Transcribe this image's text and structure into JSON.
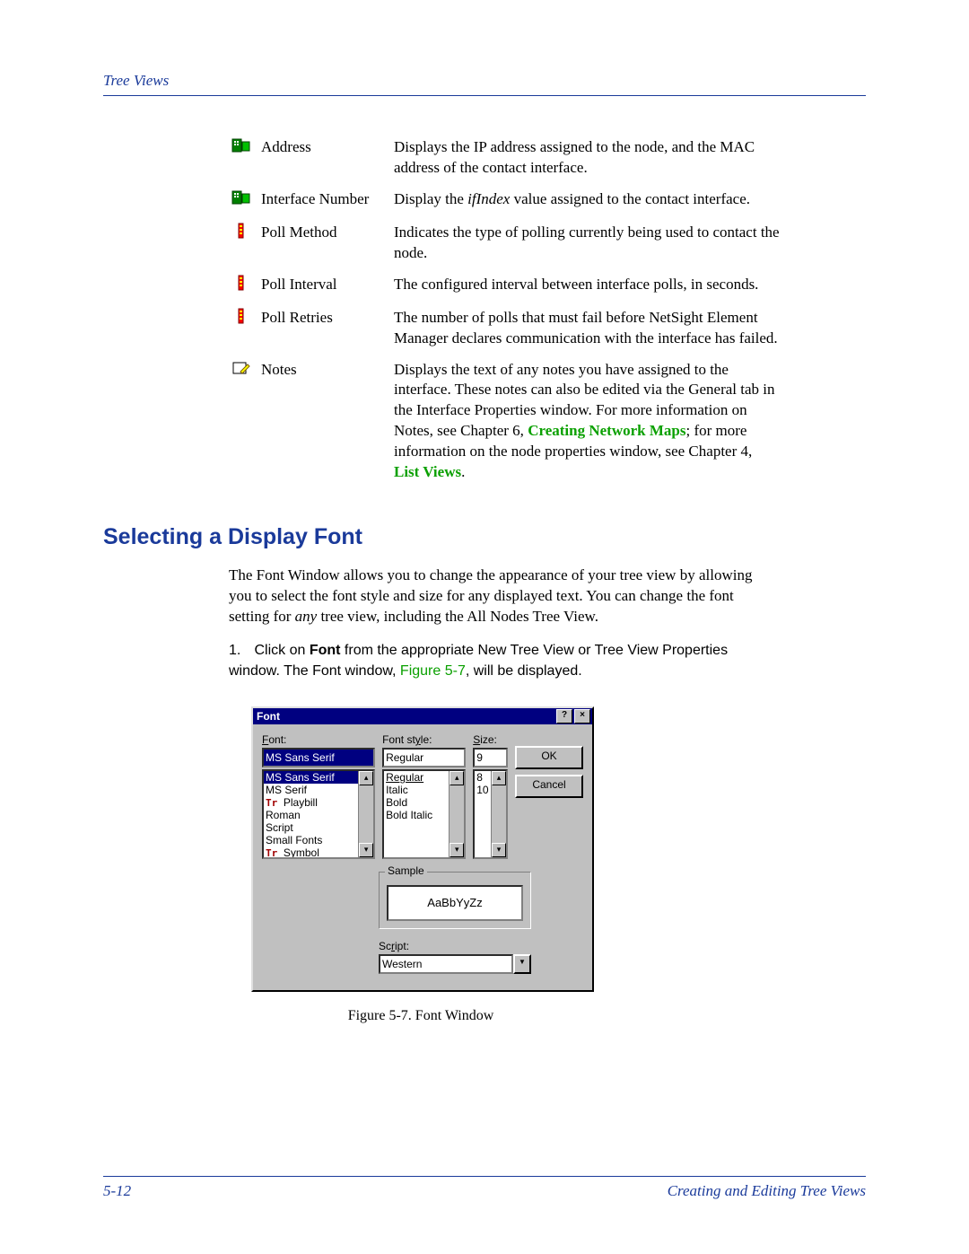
{
  "header": {
    "title": "Tree Views"
  },
  "defs": [
    {
      "icon": "node-icon",
      "term": "Address",
      "desc": "Displays the IP address assigned to the node, and the MAC address of the contact interface."
    },
    {
      "icon": "node-icon",
      "term": "Interface Number",
      "desc_pre": "Display the ",
      "desc_ital": "ifIndex",
      "desc_post": " value assigned to the contact interface."
    },
    {
      "icon": "flag-icon",
      "term": "Poll Method",
      "desc": "Indicates the type of polling currently being used to contact the node."
    },
    {
      "icon": "flag-icon",
      "term": "Poll Interval",
      "desc": "The configured interval between interface polls, in seconds."
    },
    {
      "icon": "flag-icon",
      "term": "Poll Retries",
      "desc": "The number of polls that must fail before NetSight Element Manager declares communication with the interface has failed."
    },
    {
      "icon": "notes-icon",
      "term": "Notes",
      "desc_notes_pre": "Displays the text of any notes you have assigned to the interface. These notes can also be edited via the General tab in the Interface Properties window. For more information on Notes, see Chapter 6, ",
      "link1": "Creating Network Maps",
      "desc_notes_mid": "; for more information on the node properties window, see Chapter 4, ",
      "link2": "List Views",
      "desc_notes_post": "."
    }
  ],
  "section_heading": "Selecting a Display Font",
  "para1_pre": "The Font Window allows you to change the appearance of your tree view by allowing you to select the font style and size for any displayed text. You can change the font setting for ",
  "para1_ital": "any",
  "para1_post": " tree view, including the All Nodes Tree View.",
  "step": {
    "num": "1.",
    "pre": "Click on ",
    "bold": "Font",
    "mid": " from the appropriate New Tree View or Tree View Properties window. The Font window, ",
    "figref": "Figure 5-7",
    "post": ", will be displayed."
  },
  "dialog": {
    "title": "Font",
    "help_btn": "?",
    "close_btn": "×",
    "font_label": "Font:",
    "font_value": "MS Sans Serif",
    "font_list": [
      "MS Sans Serif",
      "MS Serif",
      "Playbill",
      "Roman",
      "Script",
      "Small Fonts",
      "Symbol"
    ],
    "style_label": "Font style:",
    "style_value": "Regular",
    "style_list": [
      "Regular",
      "Italic",
      "Bold",
      "Bold Italic"
    ],
    "size_label": "Size:",
    "size_value": "9",
    "size_list": [
      "8",
      "10"
    ],
    "ok": "OK",
    "cancel": "Cancel",
    "sample_label": "Sample",
    "sample_text": "AaBbYyZz",
    "script_label": "Script:",
    "script_value": "Western"
  },
  "figure_caption": "Figure 5-7. Font Window",
  "footer": {
    "page": "5-12",
    "section": "Creating and Editing Tree Views"
  }
}
